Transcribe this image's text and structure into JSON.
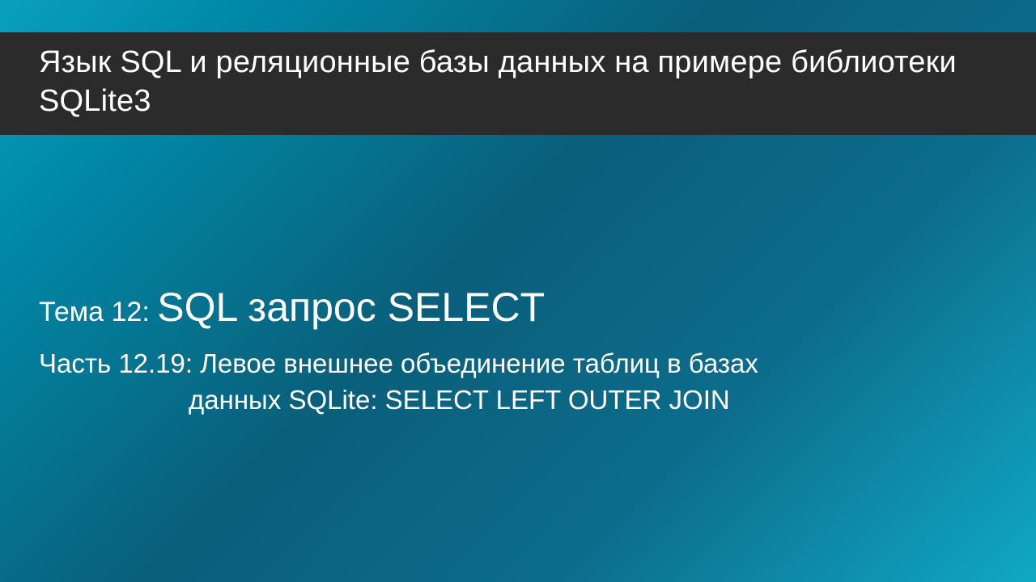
{
  "header": {
    "title": "Язык SQL и реляционные базы данных на примере библиотеки SQLite3"
  },
  "content": {
    "theme_prefix": "Тема 12: ",
    "theme_main": "SQL запрос SELECT",
    "part_prefix": "Часть 12.19: ",
    "part_text_line1": "Левое внешнее объединение таблиц в базах",
    "part_text_line2": "данных SQLite: SELECT LEFT OUTER JOIN"
  }
}
